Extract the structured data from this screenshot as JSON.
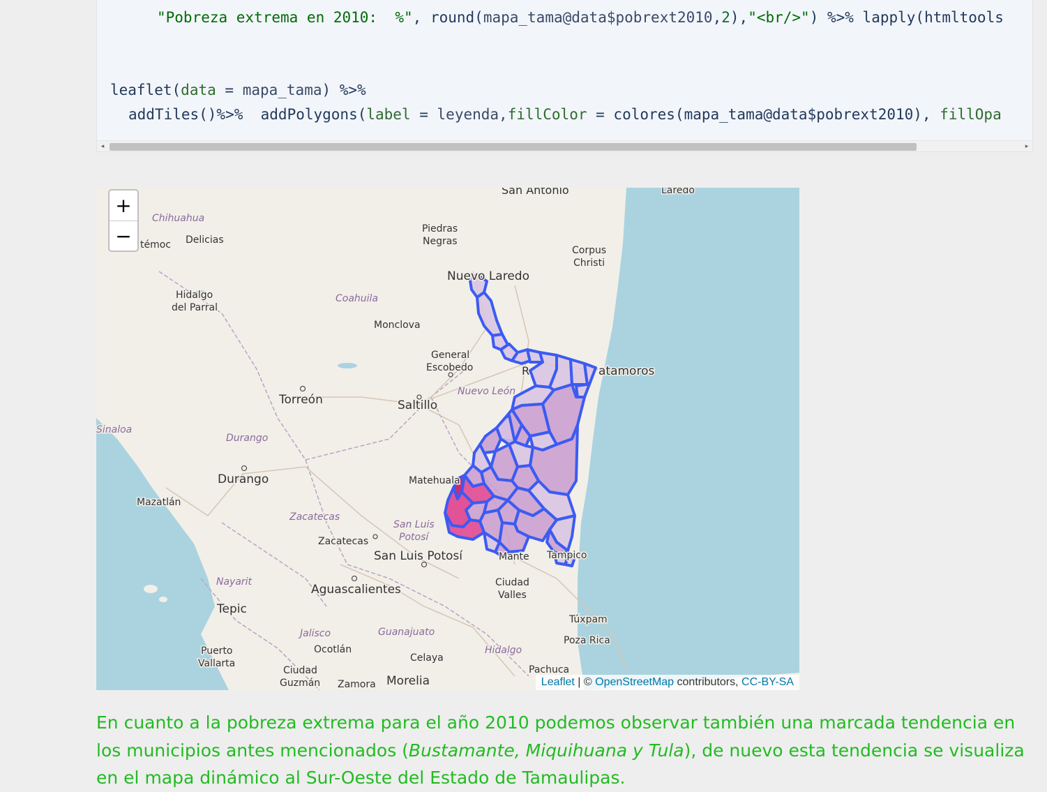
{
  "code": {
    "line1_prefix": "\"Pobreza extrema en 2010:  %\"",
    "line1_mid1": ", ",
    "line1_round": "round",
    "line1_paren_open": "(",
    "line1_obj": "mapa_tama@data$pobrext2010",
    "line1_comma": ",",
    "line1_two": "2",
    "line1_close": ")",
    "line1_comma2": ",",
    "line1_br": "\"<br/>\"",
    "line1_tail": ") %>% lapply(htmltools",
    "line2_leaflet": "leaflet",
    "line2_open": "(",
    "line2_data": "data",
    "line2_eq": " = ",
    "line2_obj": "mapa_tama",
    "line2_close": ") %>%",
    "line3_a": "addTiles()%>%  addPolygons(",
    "line3_label": "label",
    "line3_eq": " = ",
    "line3_leyenda": "leyenda,",
    "line3_fill": "fillColor",
    "line3_eq2": " = ",
    "line3_colores": "colores(mapa_tama@data$pobrext2010), ",
    "line3_fillop": "fillOpa"
  },
  "map": {
    "zoom_in": "+",
    "zoom_out": "−",
    "attribution": {
      "leaflet": "Leaflet",
      "sep": " | © ",
      "osm": "OpenStreetMap",
      "contrib": " contributors, ",
      "license": "CC-BY-SA"
    },
    "cities": {
      "san_antonio": "San Antonio",
      "laredo_top": "Laredo",
      "piedras1": "Piedras",
      "piedras2": "Negras",
      "corpus1": "Corpus",
      "corpus2": "Christi",
      "nuevo_laredo": "Nuevo Laredo",
      "cuauhtemoc": "témoc",
      "delicias": "Delicias",
      "hidalgo1": "Hidalgo",
      "hidalgo2": "del Parral",
      "monclova": "Monclova",
      "general1": "General",
      "general2": "Escobedo",
      "reynosa": "R",
      "matamoros": "atamoros",
      "torreon": "Torreón",
      "saltillo": "Saltillo",
      "durango_city": "Durango",
      "matehuala": "Matehuala",
      "mazatlan": "Mazatlán",
      "zacatecas_city": "Zacatecas",
      "slp_city": "San Luis Potosí",
      "mante": "Mante",
      "tampico": "Tampico",
      "ciudad_valles1": "Ciudad",
      "ciudad_valles2": "Valles",
      "aguascalientes": "Aguascalientes",
      "tepic": "Tepic",
      "tuxpam": "Túxpam",
      "poza_rica": "Poza Rica",
      "puerto1": "Puerto",
      "puerto2": "Vallarta",
      "ocotlan": "Ocotlán",
      "celaya": "Celaya",
      "ciudad_guzman1": "Ciudad",
      "ciudad_guzman2": "Guzmán",
      "zamora": "Zamora",
      "morelia": "Morelia",
      "pachuca": "Pachuca"
    },
    "states": {
      "chihuahua": "Chihuahua",
      "coahuila": "Coahuila",
      "nuevo_leon": "Nuevo León",
      "sinaloa": "Sinaloa",
      "durango": "Durango",
      "zacatecas": "Zacatecas",
      "slp1": "San Luis",
      "slp2": "Potosí",
      "nayarit": "Nayarit",
      "jalisco": "Jalisco",
      "guanajuato": "Guanajuato",
      "hidalgo": "Hidalgo"
    },
    "colors": {
      "land": "#f2efe9",
      "sea": "#aad3df",
      "poly_stroke": "#3b5bf2",
      "poly_light": "#d8c3e3",
      "poly_mid": "#c99bd0",
      "poly_high": "#e0408e",
      "poly_max": "#c0186a"
    }
  },
  "paragraph": {
    "part1": "En cuanto a la pobreza extrema para el año 2010 podemos observar también una marcada tendencia en los municipios antes mencionados (",
    "italic": "Bustamante, Miquihuana y Tula",
    "part2": "), de nuevo esta tendencia se visualiza en el mapa dinámico al Sur-Oeste del Estado de Tamaulipas."
  }
}
